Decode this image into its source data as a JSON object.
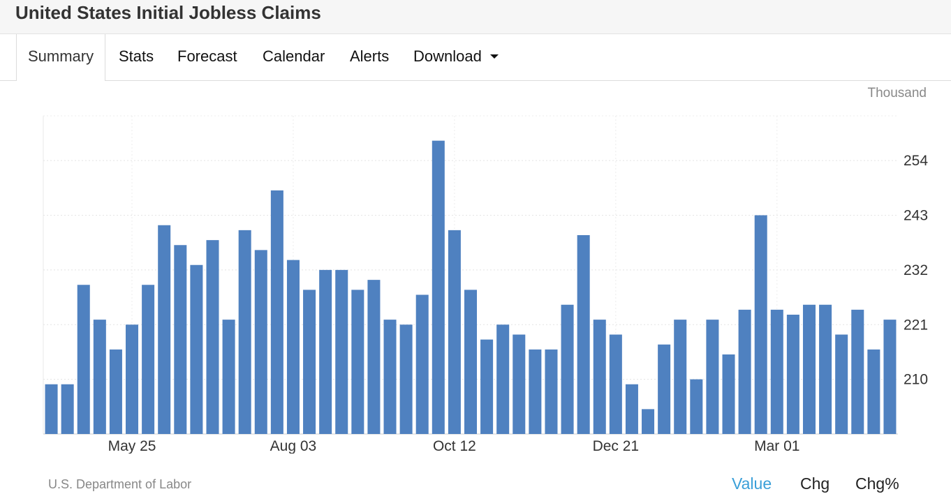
{
  "header": {
    "title": "United States Initial Jobless Claims"
  },
  "tabs": [
    {
      "label": "Summary",
      "active": true
    },
    {
      "label": "Stats"
    },
    {
      "label": "Forecast"
    },
    {
      "label": "Calendar"
    },
    {
      "label": "Alerts"
    },
    {
      "label": "Download",
      "dropdown": true
    }
  ],
  "chart_unit": "Thousand",
  "source": "U.S. Department of Labor",
  "view_toggles": {
    "value": "Value",
    "chg": "Chg",
    "chg_pct": "Chg%",
    "active": "Value",
    "active_color": "#3a9fd8"
  },
  "chart_data": {
    "type": "bar",
    "bar_color": "#4f81c0",
    "x_tick_labels": [
      {
        "label": "May 25",
        "index": 5
      },
      {
        "label": "Aug 03",
        "index": 15
      },
      {
        "label": "Oct 12",
        "index": 25
      },
      {
        "label": "Dec 21",
        "index": 35
      },
      {
        "label": "Mar 01",
        "index": 45
      }
    ],
    "y_ticks": [
      210,
      221,
      232,
      243,
      254
    ],
    "ylim": [
      199,
      263
    ],
    "y_axis_position": "right",
    "grid": true,
    "values": [
      209,
      209,
      229,
      222,
      216,
      221,
      229,
      241,
      237,
      233,
      238,
      222,
      240,
      236,
      248,
      234,
      228,
      232,
      232,
      228,
      230,
      222,
      221,
      227,
      258,
      240,
      228,
      218,
      221,
      219,
      216,
      216,
      225,
      239,
      222,
      219,
      209,
      204,
      217,
      222,
      210,
      222,
      215,
      224,
      243,
      224,
      223,
      225,
      225,
      219,
      224,
      216,
      222
    ]
  }
}
